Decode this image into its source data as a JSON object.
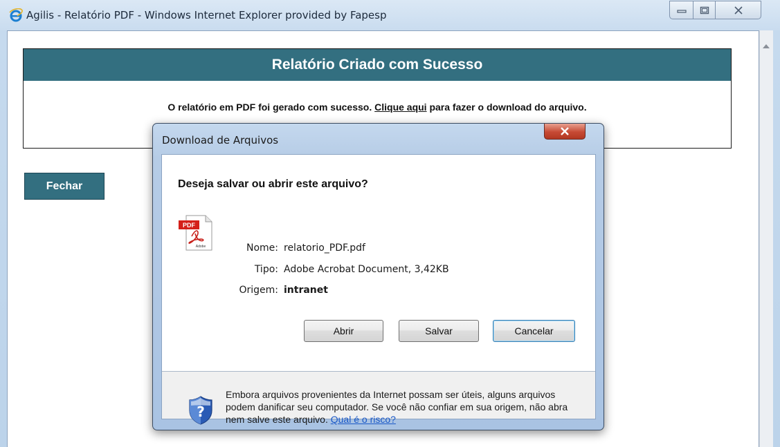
{
  "window": {
    "title": "Agilis - Relatório PDF - Windows Internet Explorer provided by Fapesp"
  },
  "page": {
    "header": "Relatório Criado com Sucesso",
    "message_before": "O relatório em PDF foi gerado com sucesso.",
    "link": "Clique aqui",
    "message_after": "para fazer o download do arquivo.",
    "close_button": "Fechar"
  },
  "dialog": {
    "title": "Download de Arquivos",
    "question": "Deseja salvar ou abrir este arquivo?",
    "file": {
      "name_label": "Nome:",
      "name": "relatorio_PDF.pdf",
      "type_label": "Tipo:",
      "type": "Adobe Acrobat Document, 3,42KB",
      "origin_label": "Origem:",
      "origin": "intranet"
    },
    "buttons": {
      "open": "Abrir",
      "save": "Salvar",
      "cancel": "Cancelar"
    },
    "warning": "Embora arquivos provenientes da Internet possam ser úteis, alguns arquivos podem danificar seu computador. Se você não confiar em sua origem, não abra nem salve este arquivo.",
    "warning_link": "Qual é o risco?",
    "pdf_icon_text": "PDF",
    "pdf_icon_brand": "Adobe"
  },
  "icons": {
    "app": "internet-explorer-icon",
    "file": "pdf-file-icon",
    "security": "shield-help-icon"
  },
  "colors": {
    "header_bg": "#336f80",
    "link_blue": "#1a58c7",
    "close_red": "#c64a34"
  }
}
